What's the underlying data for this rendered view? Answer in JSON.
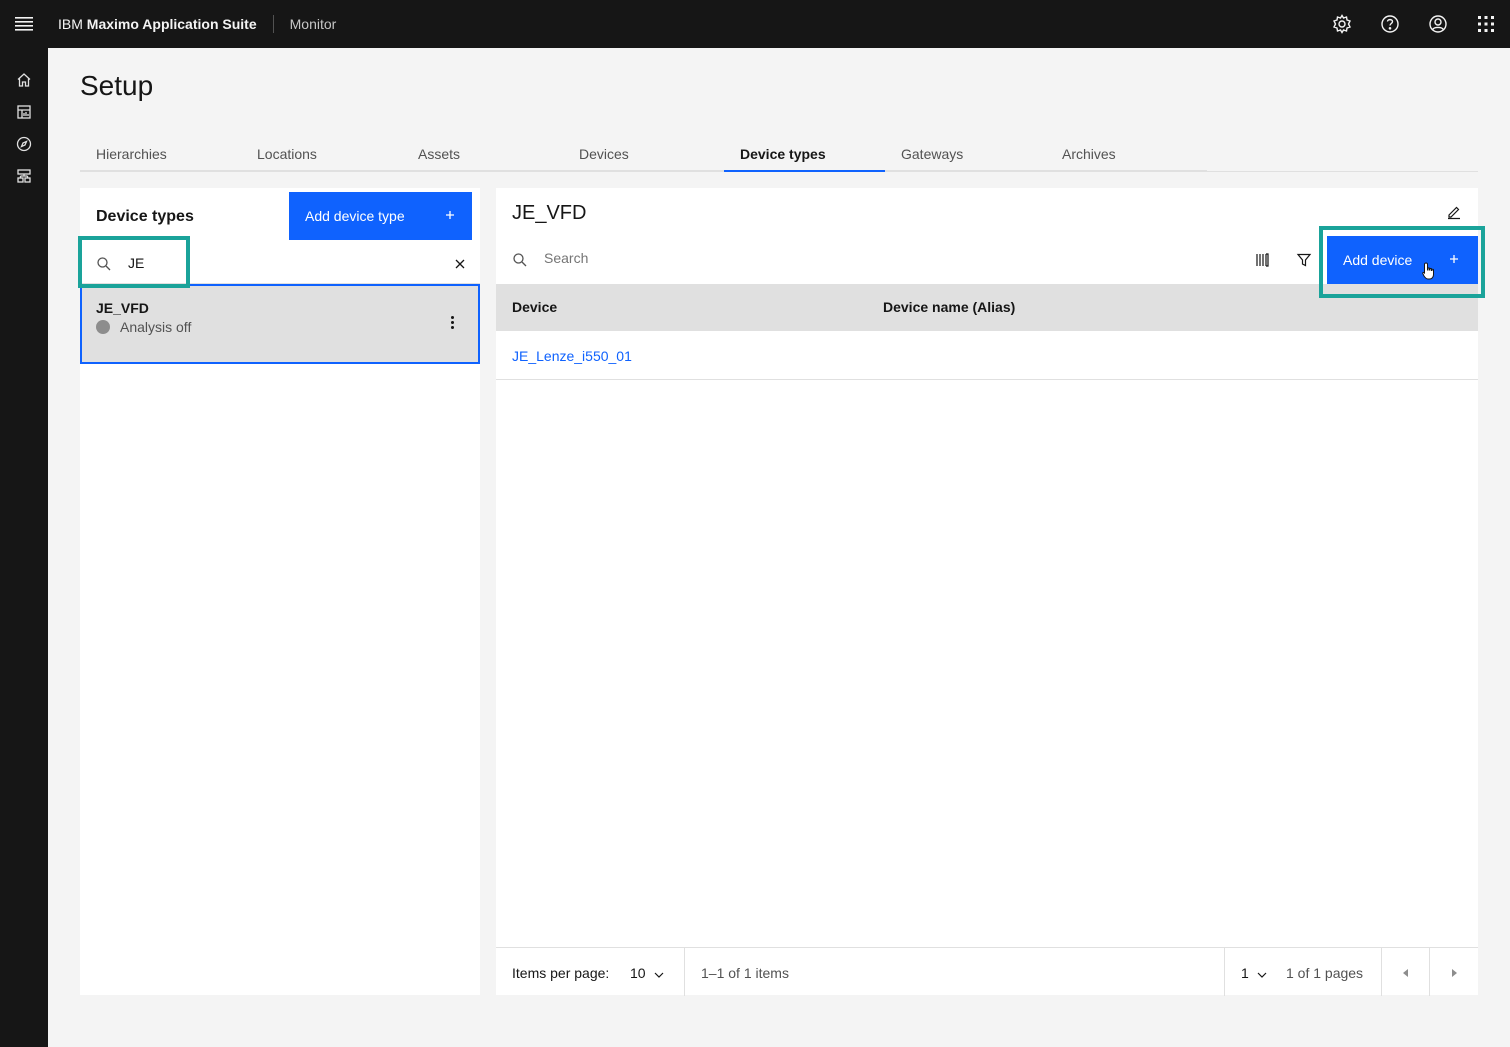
{
  "header": {
    "brand_prefix": "IBM",
    "brand_name": "Maximo Application Suite",
    "product": "Monitor",
    "icons": [
      "settings-icon",
      "help-icon",
      "user-icon",
      "app-switcher-icon"
    ]
  },
  "rail": {
    "icons": [
      "home-icon",
      "dashboard-icon",
      "explore-icon",
      "setup-icon"
    ]
  },
  "page": {
    "title": "Setup"
  },
  "tabs": [
    {
      "label": "Hierarchies",
      "active": false
    },
    {
      "label": "Locations",
      "active": false
    },
    {
      "label": "Assets",
      "active": false
    },
    {
      "label": "Devices",
      "active": false
    },
    {
      "label": "Device types",
      "active": true
    },
    {
      "label": "Gateways",
      "active": false
    },
    {
      "label": "Archives",
      "active": false
    }
  ],
  "left_panel": {
    "title": "Device types",
    "add_button": "Add device type",
    "search_value": "JE",
    "items": [
      {
        "name": "JE_VFD",
        "status": "Analysis off",
        "selected": true
      }
    ]
  },
  "right_panel": {
    "title": "JE_VFD",
    "search_placeholder": "Search",
    "add_button": "Add device",
    "columns": [
      "Device",
      "Device name (Alias)"
    ],
    "rows": [
      {
        "device": "JE_Lenze_i550_01",
        "alias": ""
      }
    ],
    "pagination": {
      "items_per_page_label": "Items per page:",
      "items_per_page": "10",
      "range": "1–1 of 1 items",
      "page": "1",
      "pages_text": "1 of 1 pages"
    }
  },
  "colors": {
    "primary": "#0f62fe",
    "highlight": "#1aa39a",
    "header_bg": "#161616"
  }
}
